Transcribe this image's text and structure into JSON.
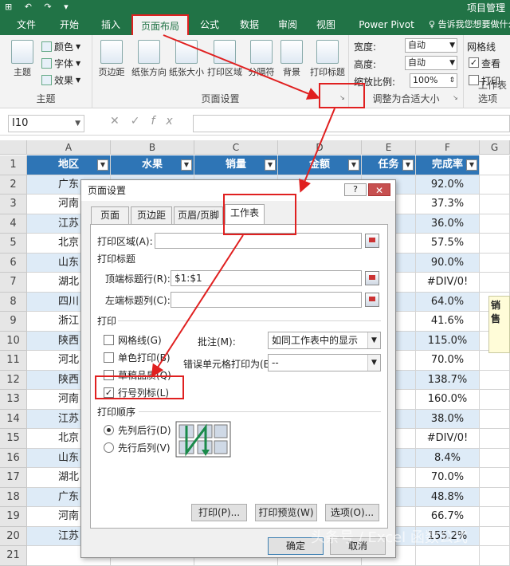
{
  "titlebar": {
    "quick_access": "⊞ ↶ ↷ ▾",
    "doc_title": "项目管理"
  },
  "ribbon_tabs": [
    "文件",
    "开始",
    "插入",
    "页面布局",
    "公式",
    "数据",
    "审阅",
    "视图",
    "Power Pivot"
  ],
  "tellme": "告诉我您想要做什么",
  "theme_group": {
    "label": "主题",
    "theme_btn": "主题",
    "colors": "颜色",
    "fonts": "字体",
    "effects": "效果"
  },
  "page_setup_group": {
    "label": "页面设置",
    "buttons": [
      "页边距",
      "纸张方向",
      "纸张大小",
      "打印区域",
      "分隔符",
      "背景",
      "打印标题"
    ]
  },
  "scale_group": {
    "label": "调整为合适大小",
    "width_label": "宽度:",
    "width_val": "自动",
    "height_label": "高度:",
    "height_val": "自动",
    "scale_label": "缩放比例:",
    "scale_val": "100%"
  },
  "sheet_opts_group": {
    "label": "工作表选项",
    "gridlines": "网格线",
    "view": "查看",
    "print": "打印"
  },
  "formula_bar": {
    "name_box": "I10",
    "fx": "fx",
    "formula": ""
  },
  "columns": [
    "A",
    "B",
    "C",
    "D",
    "E",
    "F",
    "G"
  ],
  "headers": [
    "地区",
    "水果",
    "销量",
    "金额",
    "任务",
    "完成率"
  ],
  "rows": [
    "1",
    "2",
    "3",
    "4",
    "5",
    "6",
    "7",
    "8",
    "9",
    "10",
    "11",
    "12",
    "13",
    "14",
    "15",
    "16",
    "17",
    "18",
    "19",
    "20",
    "21"
  ],
  "col_a": [
    "广东",
    "河南",
    "江苏",
    "北京",
    "山东",
    "湖北",
    "四川",
    "浙江",
    "陕西",
    "河北",
    "陕西",
    "河南",
    "江苏",
    "北京",
    "山东",
    "湖北",
    "广东",
    "河南",
    "江苏",
    ""
  ],
  "col_f": [
    "92.0%",
    "37.3%",
    "36.0%",
    "57.5%",
    "90.0%",
    "#DIV/0!",
    "64.0%",
    "41.6%",
    "115.0%",
    "70.0%",
    "138.7%",
    "160.0%",
    "38.0%",
    "#DIV/0!",
    "8.4%",
    "70.0%",
    "48.8%",
    "66.7%",
    "155.2%",
    ""
  ],
  "note_text": "销售",
  "dialog": {
    "title": "页面设置",
    "help": "?",
    "close": "✕",
    "tabs": [
      "页面",
      "页边距",
      "页眉/页脚",
      "工作表"
    ],
    "print_area_label": "打印区域(A):",
    "print_area_value": "",
    "print_titles_label": "打印标题",
    "top_rows_label": "顶端标题行(R):",
    "top_rows_value": "$1:$1",
    "left_cols_label": "左端标题列(C):",
    "left_cols_value": "",
    "print_section": "打印",
    "gridlines_chk": "网格线(G)",
    "mono_chk": "单色打印(B)",
    "draft_chk": "草稿品质(Q)",
    "rowcol_chk": "行号列标(L)",
    "rowcol_checked": "✓",
    "comments_label": "批注(M):",
    "comments_value": "如同工作表中的显示",
    "errors_label": "错误单元格打印为(E):",
    "errors_value": "--",
    "order_section": "打印顺序",
    "order_down": "先列后行(D)",
    "order_over": "先行后列(V)",
    "btn_print": "打印(P)...",
    "btn_preview": "打印预览(W)",
    "btn_options": "选项(O)...",
    "btn_ok": "确定",
    "btn_cancel": "取消"
  },
  "watermark": "头条号 / Excel 函数公式",
  "colors": {
    "excel_green": "#217346",
    "header_blue": "#2e75b6",
    "highlight_red": "#e02020"
  }
}
